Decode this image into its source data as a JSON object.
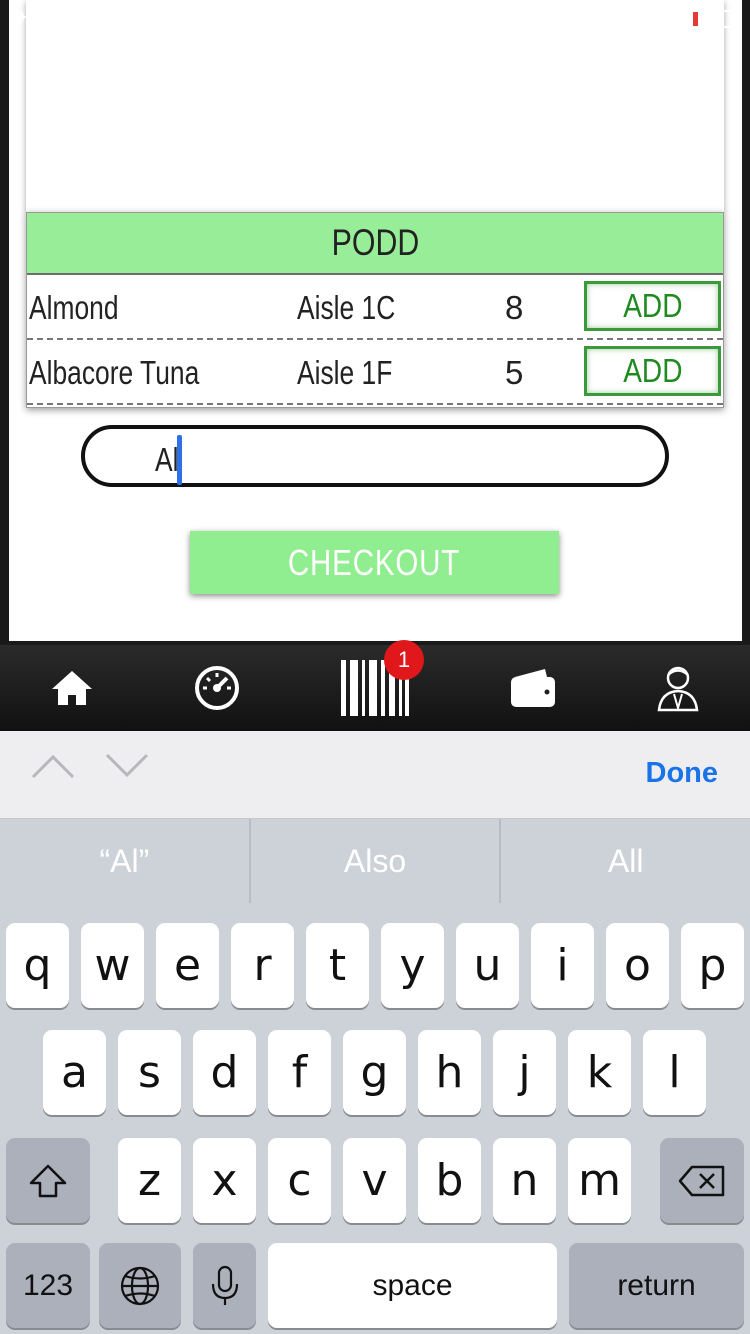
{
  "app": {
    "podd_title": "PODD",
    "items": [
      {
        "name": "Almond",
        "aisle": "Aisle 1C",
        "qty": "8",
        "add_label": "ADD"
      },
      {
        "name": "Albacore Tuna",
        "aisle": "Aisle 1F",
        "qty": "5",
        "add_label": "ADD"
      }
    ],
    "search": {
      "value": "Al"
    },
    "checkout_label": "CHECKOUT"
  },
  "tab_bar": {
    "icons": [
      "home-icon",
      "speedometer-icon",
      "barcode-icon",
      "wallet-icon",
      "profile-icon"
    ],
    "badge_count": "1"
  },
  "keyboard_toolbar": {
    "done_label": "Done"
  },
  "suggestions": [
    "“Al”",
    "Also",
    "All"
  ],
  "keyboard": {
    "row1": [
      "q",
      "w",
      "e",
      "r",
      "t",
      "y",
      "u",
      "i",
      "o",
      "p"
    ],
    "row2": [
      "a",
      "s",
      "d",
      "f",
      "g",
      "h",
      "j",
      "k",
      "l"
    ],
    "row3": [
      "z",
      "x",
      "c",
      "v",
      "b",
      "n",
      "m"
    ],
    "numbers_label": "123",
    "space_label": "space",
    "return_label": "return"
  },
  "colors": {
    "accent_green": "#98ee98",
    "add_green": "#1f8a1f",
    "badge_red": "#e0181c",
    "done_blue": "#1a73e8"
  }
}
